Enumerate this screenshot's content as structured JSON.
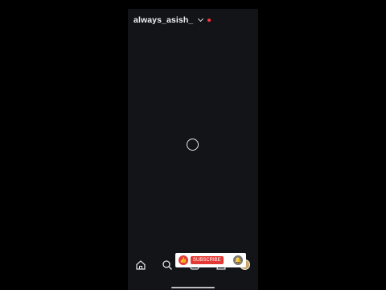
{
  "profile": {
    "username": "always_asish_"
  },
  "overlay": {
    "subscribe_label": "SUBSCRIBE"
  },
  "colors": {
    "notification_dot": "#ff3040",
    "background": "#121418",
    "accent": "#e53935"
  },
  "icons": {
    "home": "home-icon",
    "search": "search-icon",
    "reels": "reels-icon",
    "shop": "shop-icon"
  }
}
